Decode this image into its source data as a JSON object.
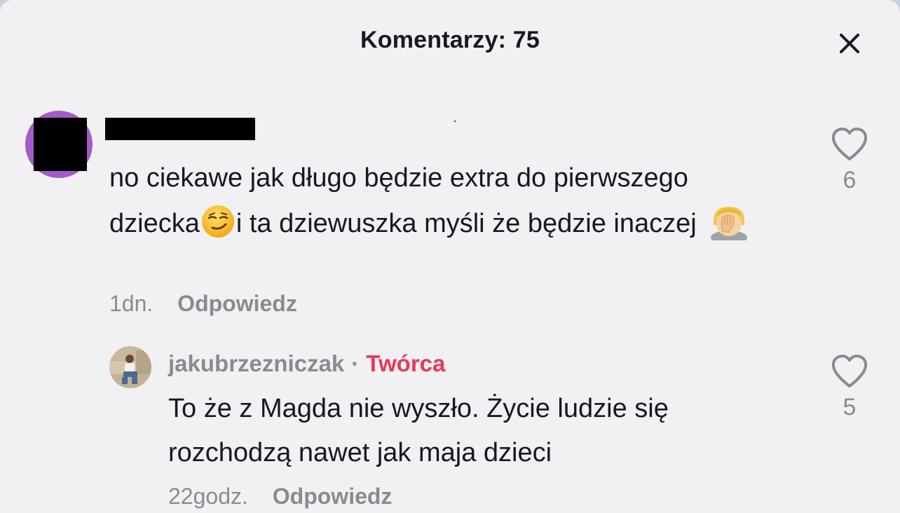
{
  "header": {
    "title": "Komentarzy: 75"
  },
  "comments": [
    {
      "text_before": "no ciekawe jak długo będzie extra do pierwszego dziecka",
      "text_middle": "i ta dziewuszka myśli że będzie inaczej ",
      "emojis": [
        "smirk-emoji",
        "facepalm-emoji"
      ],
      "time": "1dn.",
      "reply_label": "Odpowiedz",
      "likes": "6",
      "replies": [
        {
          "username": "jakubrzezniczak",
          "separator": "·",
          "badge": "Twórca",
          "text": "To że z Magda nie wyszło. Życie ludzie się rozchodzą nawet jak maja dzieci",
          "time": "22godz.",
          "reply_label": "Odpowiedz",
          "likes": "5"
        }
      ]
    }
  ],
  "colors": {
    "background": "#f1f1f3",
    "text_primary": "#161823",
    "text_secondary": "#8a8b91",
    "creator_badge": "#e63a57",
    "avatar_ring": "#a35bc7"
  }
}
